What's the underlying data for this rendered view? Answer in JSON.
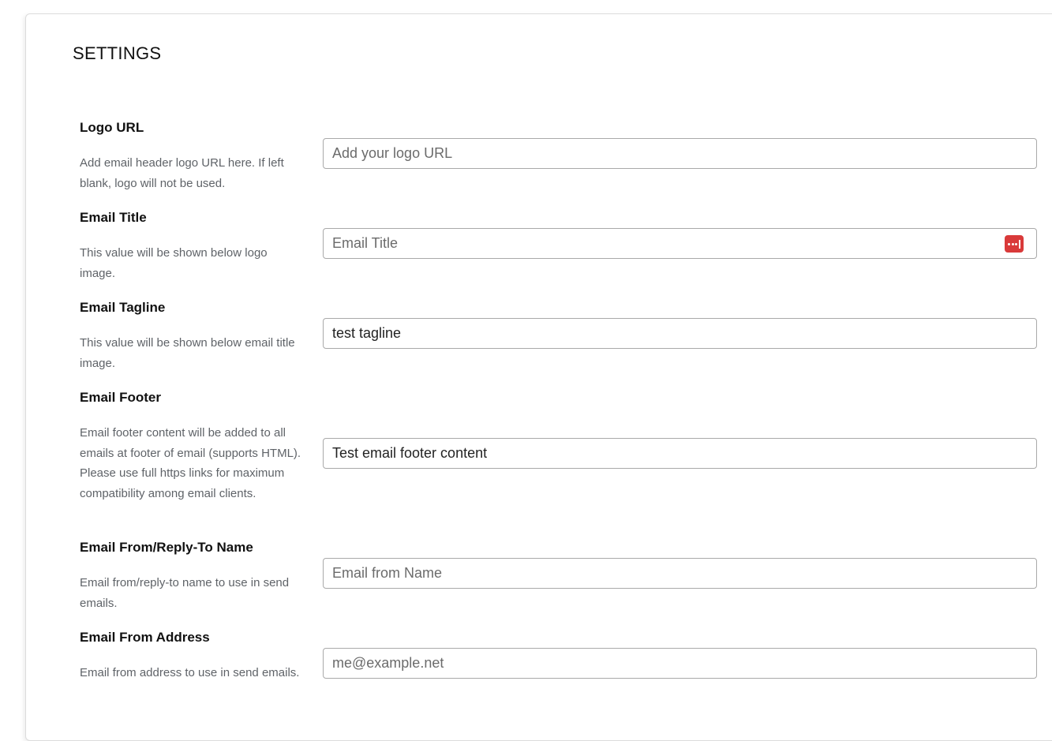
{
  "settings": {
    "title": "SETTINGS",
    "fields": [
      {
        "label": "Logo URL",
        "description": "Add email header logo URL here. If left blank, logo will not be used.",
        "value": "",
        "placeholder": "Add your logo URL"
      },
      {
        "label": "Email Title",
        "description": "This value will be shown below logo image.",
        "value": "",
        "placeholder": "Email Title",
        "icon": "password-manager-icon"
      },
      {
        "label": "Email Tagline",
        "description": "This value will be shown below email title image.",
        "value": "test tagline",
        "placeholder": ""
      },
      {
        "label": "Email Footer",
        "description": "Email footer content will be added to all emails at footer of email (supports HTML). Please use full https links for maximum compatibility among email clients.",
        "value": "Test email footer content",
        "placeholder": ""
      },
      {
        "label": "Email From/Reply-To Name",
        "description": "Email from/reply-to name to use in send emails.",
        "value": "",
        "placeholder": "Email from Name"
      },
      {
        "label": "Email From Address",
        "description": "Email from address to use in send emails.",
        "value": "",
        "placeholder": "me@example.net"
      }
    ]
  },
  "colors": {
    "border": "#a9a9a9",
    "icon_accent": "#d93a3a",
    "description_text": "#5f6368"
  }
}
